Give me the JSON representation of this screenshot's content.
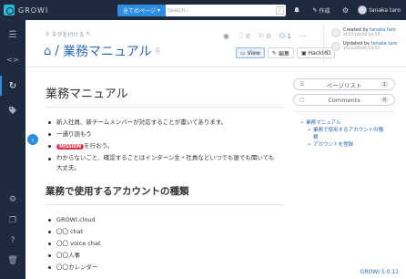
{
  "navbar": {
    "brand": "GROWI",
    "search_scope": "全てのページ",
    "search_placeholder": "Search...",
    "shortcut": "/",
    "create_label": "作成",
    "user_name": "tanaka taro"
  },
  "page": {
    "tag_placeholder": "タグを付ける",
    "title_sep": "/",
    "title": "業務マニュアル",
    "like_count": "0",
    "bookmark_count": "0",
    "seen_count": "1",
    "views": [
      "View",
      "編集",
      "HackMD"
    ],
    "created_prefix": "Created by",
    "created_by": "tanaka taro",
    "created_at": "2022/06/08 18:50",
    "updated_prefix": "Updated by",
    "updated_by": "tanaka taro",
    "updated_at": "2022/06/08 18:50"
  },
  "content": {
    "h1": "業務マニュアル",
    "bullets1": [
      "新入社員、新チームメンバーが対応することが書いてあります。",
      "一通り読もう",
      "を行おう。",
      "わからないこと、確認することはインターン生・社員などいつでも誰でも聞いても",
      "大丈夫。"
    ],
    "mission_label": "MISSION",
    "h2": "業務で使用するアカウントの種類",
    "bullets2": [
      "GROWI.cloud",
      "〇〇 chat",
      "〇〇 voice chat",
      "〇〇人事",
      "〇〇カレンダー"
    ]
  },
  "rpanel": {
    "page_list_label": "ページリスト",
    "page_list_count": "1",
    "comments_label": "Comments",
    "comments_count": "0",
    "toc": [
      "業務マニュアル",
      "業務で使用するアカウントの種",
      "類",
      "アカウントを登録"
    ]
  },
  "footer": {
    "version": "GROWI 5.0.11"
  }
}
